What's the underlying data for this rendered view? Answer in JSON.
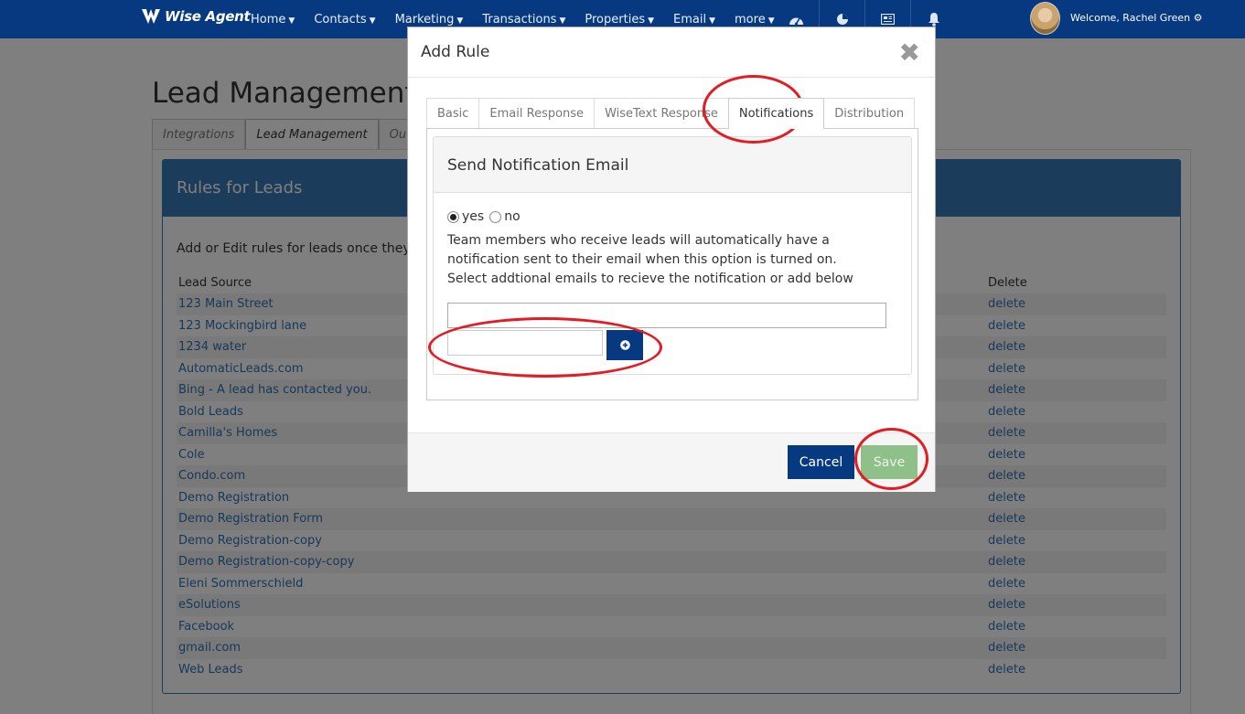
{
  "nav": {
    "logo_text": "Wise Agent",
    "items": [
      {
        "label": "Home"
      },
      {
        "label": "Contacts"
      },
      {
        "label": "Marketing"
      },
      {
        "label": "Transactions"
      },
      {
        "label": "Properties"
      },
      {
        "label": "Email"
      },
      {
        "label": "more"
      }
    ],
    "welcome": "Welcome, Rachel Green"
  },
  "page": {
    "title": "Lead Management",
    "tabs": [
      {
        "label": "Integrations"
      },
      {
        "label": "Lead Management"
      },
      {
        "label": "Outsid"
      }
    ]
  },
  "rules": {
    "title": "Rules for Leads",
    "description": "Add or Edit rules for leads once they",
    "col_source": "Lead Source",
    "col_delete": "Delete",
    "delete_label": "delete",
    "rows": [
      "123 Main Street",
      "123 Mockingbird lane",
      "1234 water",
      "AutomaticLeads.com",
      "Bing - A lead has contacted you.",
      "Bold Leads",
      "Camilla's Homes",
      "Cole",
      "Condo.com",
      "Demo Registration",
      "Demo Registration Form",
      "Demo Registration-copy",
      "Demo Registration-copy-copy",
      "Eleni Sommerschield",
      "eSolutions",
      "Facebook",
      "gmail.com",
      "Web Leads"
    ]
  },
  "modal": {
    "title": "Add Rule",
    "tabs": [
      {
        "label": "Basic"
      },
      {
        "label": "Email Response"
      },
      {
        "label": "WiseText Response"
      },
      {
        "label": "Notifications"
      },
      {
        "label": "Distribution"
      }
    ],
    "active_tab": "Notifications",
    "panel_title": "Send Notification Email",
    "radio_yes": "yes",
    "radio_no": "no",
    "help_line1": "Team members who receive leads will automatically have a notification sent to their email when this option is turned on.",
    "help_line2": "Select addtional emails to recieve the notification or add below",
    "email_select_value": "",
    "email_input_value": "",
    "cancel_label": "Cancel",
    "save_label": "Save"
  },
  "colors": {
    "nav_bg": "#06397f",
    "panel_blue": "#3679b6",
    "save_green": "#8fc08a",
    "annotation_red": "#e31b23"
  }
}
